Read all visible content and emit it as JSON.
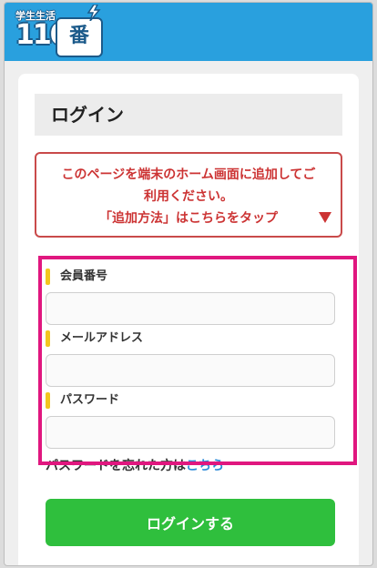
{
  "header": {
    "logo_small": "学生生活",
    "logo_number": "110",
    "logo_badge": "番",
    "brand_color": "#29a0de"
  },
  "login": {
    "title": "ログイン",
    "notice_line1": "このページを端末のホーム画面に追加してご",
    "notice_line2": "利用ください。",
    "notice_line3": "「追加方法」はこちらをタップ",
    "fields": [
      {
        "label": "会員番号",
        "value": ""
      },
      {
        "label": "メールアドレス",
        "value": ""
      },
      {
        "label": "パスワード",
        "value": ""
      }
    ],
    "forgot_text": "パスワードを忘れた方は",
    "forgot_link": "こちら",
    "submit_label": "ログインする",
    "highlight_color": "#e0177f",
    "button_color": "#2fbf3d"
  }
}
